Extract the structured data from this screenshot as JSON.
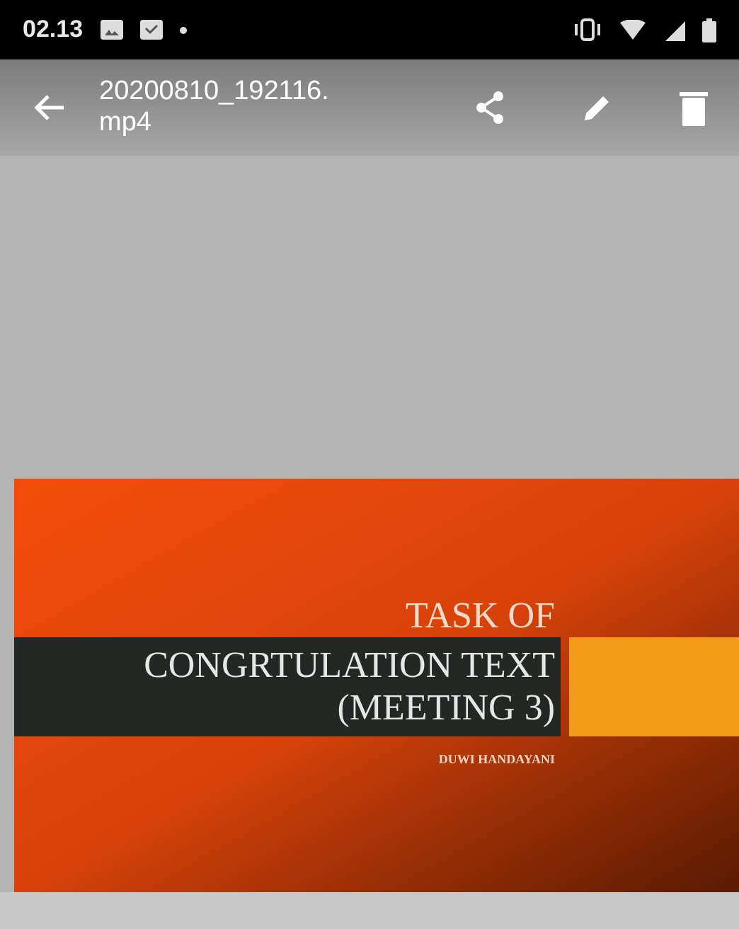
{
  "status_bar": {
    "time": "02.13"
  },
  "app_bar": {
    "title": "20200810_192116.\nmp4"
  },
  "slide": {
    "title": [
      "TASK OF",
      "CONGRTULATION TEXT",
      "(MEETING 3)"
    ],
    "author": "DUWI HANDAYANI"
  }
}
